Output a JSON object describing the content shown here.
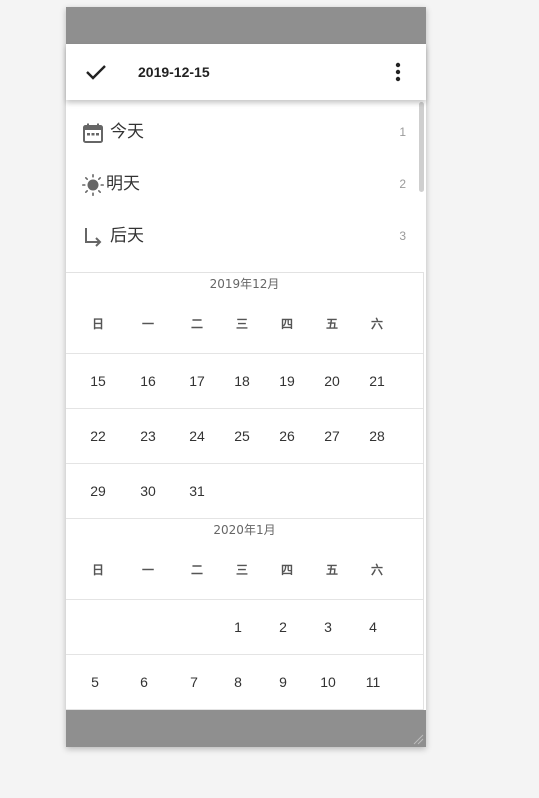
{
  "header": {
    "date": "2019-12-15",
    "confirm_icon": "check-icon",
    "menu_icon": "more-vertical-icon"
  },
  "quick_picks": [
    {
      "label": "今天",
      "shortcut": "1",
      "icon": "calendar-icon"
    },
    {
      "label": "明天",
      "shortcut": "2",
      "icon": "sun-icon"
    },
    {
      "label": "后天",
      "shortcut": "3",
      "icon": "arrow-turn-right-icon"
    }
  ],
  "calendar": {
    "weekdays": [
      "日",
      "一",
      "二",
      "三",
      "四",
      "五",
      "六"
    ],
    "months": [
      {
        "title": "2019年12月",
        "weeks": [
          [
            "15",
            "16",
            "17",
            "18",
            "19",
            "20",
            "21"
          ],
          [
            "22",
            "23",
            "24",
            "25",
            "26",
            "27",
            "28"
          ],
          [
            "29",
            "30",
            "31",
            "",
            "",
            "",
            ""
          ]
        ]
      },
      {
        "title": "2020年1月",
        "weeks": [
          [
            "",
            "",
            "",
            "1",
            "2",
            "3",
            "4"
          ],
          [
            "5",
            "6",
            "7",
            "8",
            "9",
            "10",
            "11"
          ]
        ]
      }
    ]
  }
}
